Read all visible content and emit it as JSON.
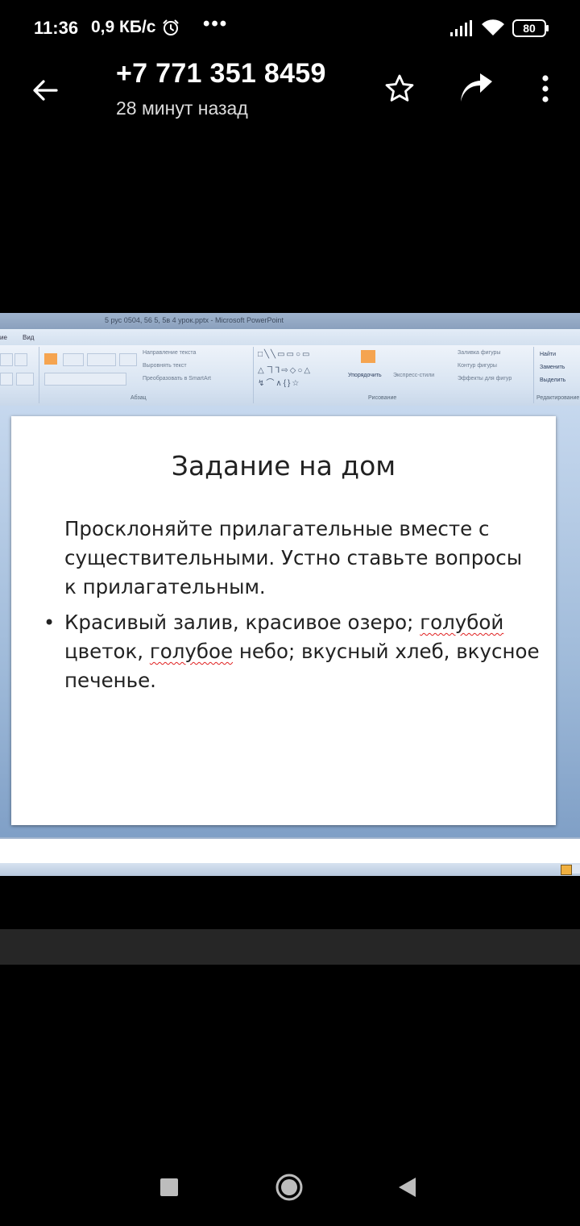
{
  "status_bar": {
    "time": "11:36",
    "speed": "0,9 КБ/с",
    "dots": "•••",
    "battery": "80",
    "icons": [
      "alarm-icon",
      "signal-icon",
      "wifi-icon",
      "battery-icon"
    ]
  },
  "header": {
    "title": "+7 771 351 8459",
    "subtitle": "28 минут назад",
    "icons": [
      "back-arrow-icon",
      "star-icon",
      "share-icon",
      "more-vert-icon"
    ]
  },
  "image": {
    "window_title": "5 рус 0504, 56 5, 5в 4 урок.pptx - Microsoft PowerPoint",
    "tab_left": "ие",
    "tab_view": "Вид",
    "ribbon": {
      "paragraph_items": [
        "Направление текста",
        "Выровнять текст",
        "Преобразовать в SmartArt"
      ],
      "paragraph_group": "Абзац",
      "arrange_label": "Упорядочить",
      "express_styles": "Экспресс-стили",
      "shape_options": [
        "Заливка фигуры",
        "Контур фигуры",
        "Эффекты для фигур"
      ],
      "drawing_group": "Рисование",
      "editing_items": [
        "Найти",
        "Заменить",
        "Выделить"
      ],
      "editing_group": "Редактирование"
    },
    "slide": {
      "title": "Задание на дом",
      "paragraph": "Просклоняйте прилагательные вместе с существительными. Устно ставьте вопросы к прилагательным.",
      "bullet_part1": "Красивый залив, красивое озеро; ",
      "bullet_word1": "голубой",
      "bullet_part2": " цветок, ",
      "bullet_word2": "голубое",
      "bullet_part3": " небо; вкусный хлеб, вкусное печенье."
    }
  },
  "nav_bar": {
    "icons": [
      "recents-square-icon",
      "home-circle-icon",
      "back-triangle-icon"
    ]
  },
  "colors": {
    "background": "#000000",
    "strip": "#262626",
    "nav_icon": "#bdbdbd",
    "spell_underline": "#e02020"
  }
}
